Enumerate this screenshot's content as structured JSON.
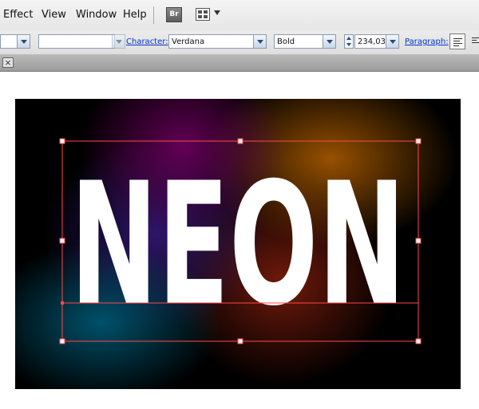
{
  "menu": {
    "items": [
      "Effect",
      "View",
      "Window",
      "Help"
    ]
  },
  "bridge_button": {
    "label": "Br"
  },
  "control_bar": {
    "character_link": "Character:",
    "font_family": "Verdana",
    "font_style": "Bold",
    "font_size": "234,03",
    "paragraph_link": "Paragraph:"
  },
  "artwork": {
    "text": "NEON",
    "colors": {
      "background": "#000000",
      "text": "#ffffff",
      "selection": "#ff4a4a",
      "glow": [
        "#005f7d",
        "#6e005f",
        "#37197d",
        "#a05500",
        "#7d1c0c"
      ]
    }
  }
}
